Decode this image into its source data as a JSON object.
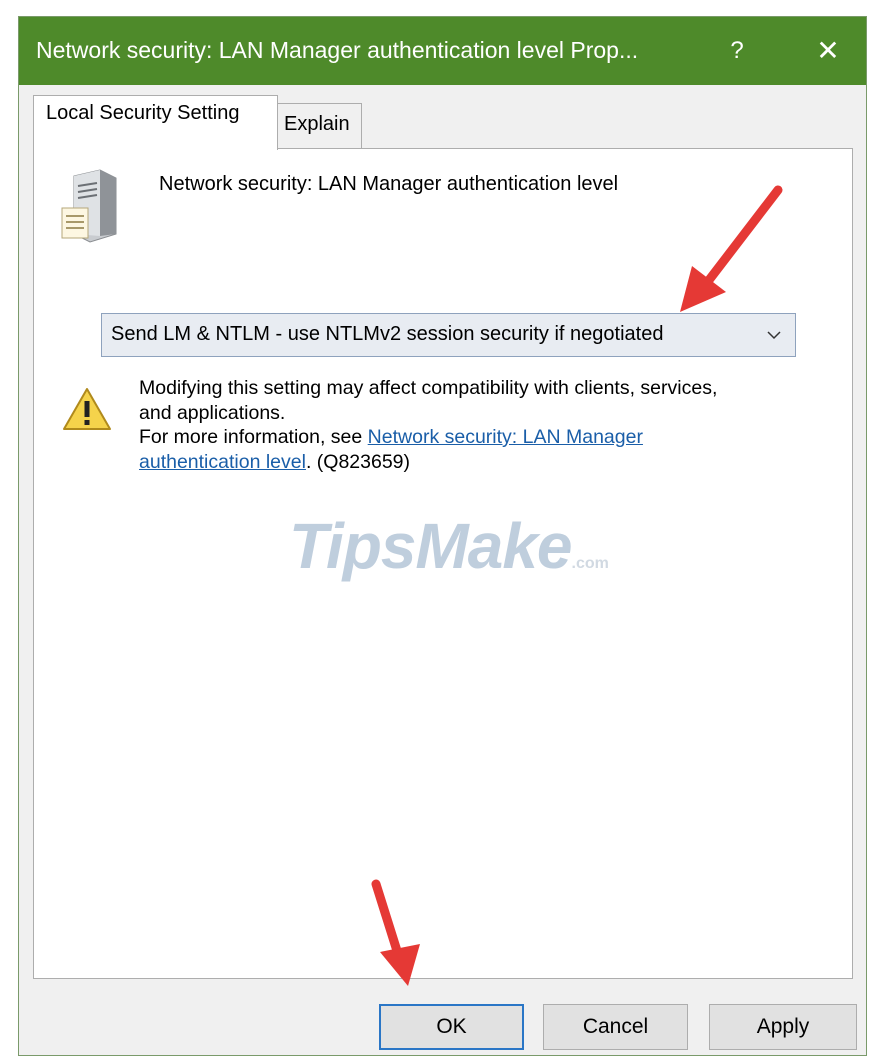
{
  "window": {
    "title": "Network security: LAN Manager authentication level Prop...",
    "help_label": "?",
    "close_label": "✕"
  },
  "tabs": [
    {
      "label": "Local Security Setting",
      "active": true
    },
    {
      "label": "Explain",
      "active": false
    }
  ],
  "policy": {
    "icon": "server-icon",
    "name": "Network security: LAN Manager authentication level"
  },
  "dropdown": {
    "selected": "Send LM & NTLM - use NTLMv2 session security if negotiated",
    "icon": "chevron-down-icon"
  },
  "warning": {
    "icon": "warning-icon",
    "line1": "Modifying this setting may affect compatibility with clients, services,",
    "line2": "and applications.",
    "line3_prefix": "For more information, see ",
    "link_part1": "Network security: LAN Manager",
    "link_part2": "authentication level",
    "suffix": ". (Q823659)"
  },
  "watermark": {
    "text": "TipsMake",
    "suffix": ".com"
  },
  "buttons": {
    "ok": "OK",
    "cancel": "Cancel",
    "apply": "Apply"
  },
  "colors": {
    "titlebar": "#4e8a2a",
    "link": "#1a5ea8",
    "annotation_arrow": "#e53935",
    "focus_border": "#2a76c6"
  }
}
